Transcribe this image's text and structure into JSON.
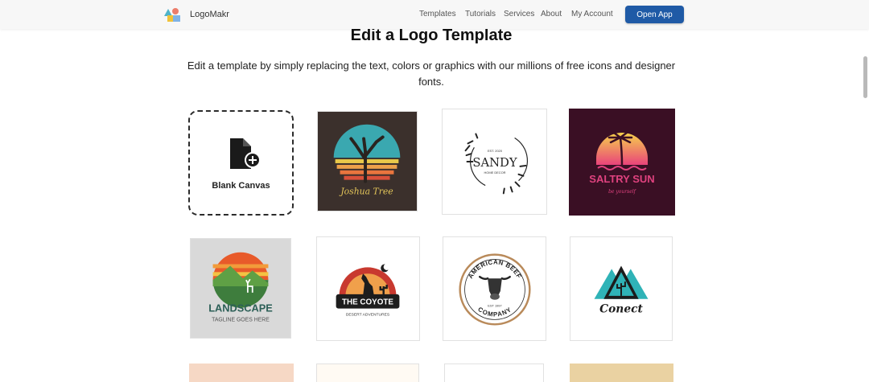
{
  "header": {
    "brand": "LogoMakr",
    "nav": [
      "Templates",
      "Tutorials",
      "Services",
      "About",
      "My Account"
    ],
    "cta": "Open App"
  },
  "main": {
    "title": "Edit a Logo Template",
    "subtitle": "Edit a template by simply replacing the text, colors or graphics with our millions of free icons and designer fonts."
  },
  "templates": {
    "blank_label": "Blank Canvas",
    "joshua_tree": "Joshua Tree",
    "sandy": "SANDY",
    "sandy_top": "EST. 2020",
    "sandy_bottom": "HOME DECOR",
    "saltry": "SALTRY SUN",
    "saltry_tag": "be yourself",
    "landscape": "LANDSCAPE",
    "landscape_tag": "TAGLINE GOES HERE",
    "coyote": "THE COYOTE",
    "coyote_tag": "DESERT ADVENTURES",
    "beef_top": "AMERICAN BEEF",
    "beef_bottom": "COMPANY",
    "beef_est": "EST 1997",
    "conect": "Conect"
  },
  "colors": {
    "brand_blue": "#1f5aa6",
    "joshua_bg": "#3b302c",
    "saltry_bg": "#3a0f24",
    "saltry_text": "#e0427f",
    "coyote_red": "#c8392f"
  }
}
